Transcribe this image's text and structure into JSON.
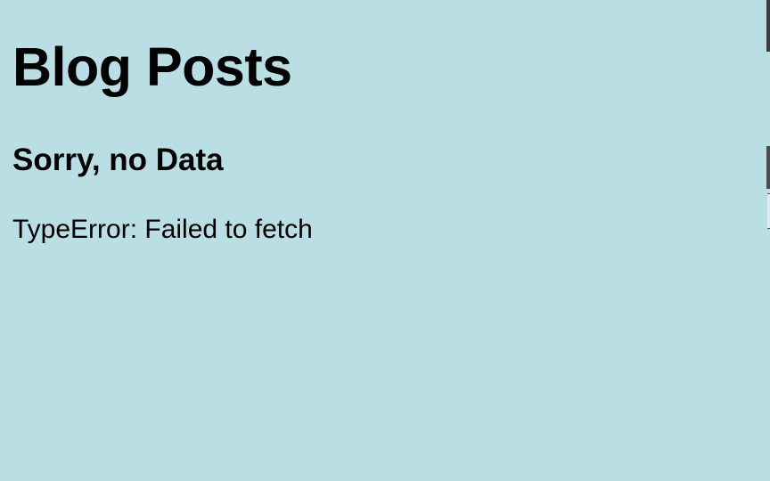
{
  "page": {
    "title": "Blog Posts",
    "error_heading": "Sorry, no Data",
    "error_message": "TypeError: Failed to fetch",
    "background_color": "#b9dee3"
  }
}
